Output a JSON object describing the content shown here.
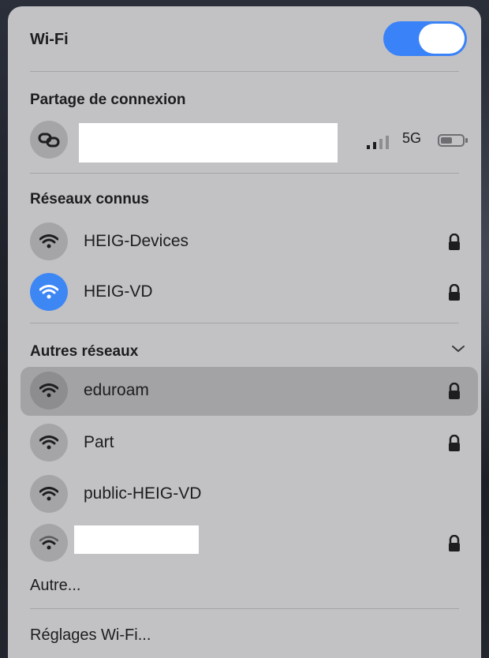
{
  "wifi": {
    "title": "Wi-Fi",
    "enabled": true,
    "accent": "#3a82f7"
  },
  "hotspot": {
    "title": "Partage de connexion",
    "network_type": "5G",
    "icon": "link-icon"
  },
  "known_networks": {
    "title": "Réseaux connus",
    "items": [
      {
        "name": "HEIG-Devices",
        "secured": true,
        "connected": false
      },
      {
        "name": "HEIG-VD",
        "secured": true,
        "connected": true
      }
    ]
  },
  "other_networks": {
    "title": "Autres réseaux",
    "items": [
      {
        "name": "eduroam",
        "secured": true,
        "highlighted": true
      },
      {
        "name": "Part",
        "secured": true
      },
      {
        "name": "public-HEIG-VD",
        "secured": false
      },
      {
        "name": "",
        "secured": true
      }
    ]
  },
  "other_label": "Autre...",
  "settings_label": "Réglages Wi-Fi..."
}
